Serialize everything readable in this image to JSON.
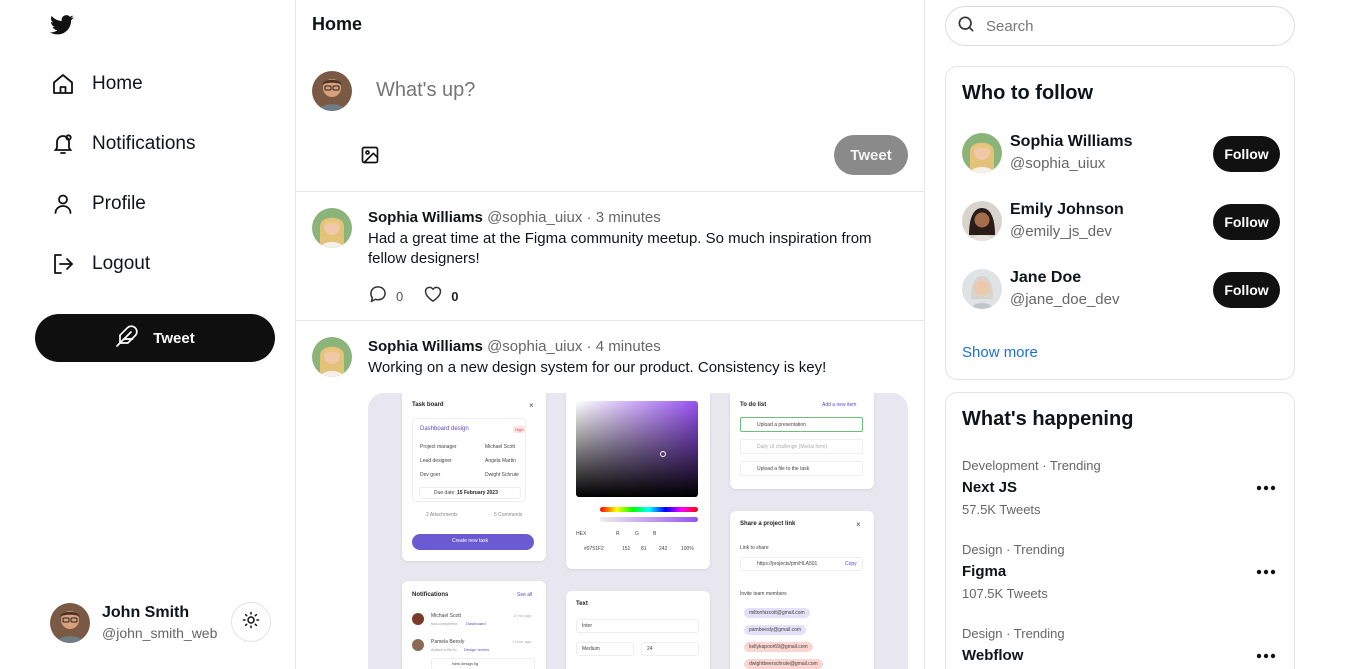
{
  "sidebar": {
    "logo_icon": "twitter-bird-icon",
    "nav": [
      {
        "label": "Home",
        "icon": "home-icon"
      },
      {
        "label": "Notifications",
        "icon": "bell-icon"
      },
      {
        "label": "Profile",
        "icon": "user-icon"
      },
      {
        "label": "Logout",
        "icon": "logout-icon"
      }
    ],
    "tweet_button": {
      "label": "Tweet",
      "icon": "feather-icon"
    },
    "current_user": {
      "name": "John Smith",
      "handle": "@john_smith_web"
    },
    "theme_toggle_icon": "sun-icon"
  },
  "main": {
    "title": "Home",
    "composer": {
      "placeholder": "What's up?",
      "media_icon": "image-icon",
      "tweet_label": "Tweet"
    },
    "posts": [
      {
        "author": "Sophia Williams",
        "handle": "@sophia_uiux",
        "dot": "·",
        "time": "3 minutes",
        "text": "Had a great time at the Figma community meetup. So much inspiration from fellow designers!",
        "comments": "0",
        "likes": "0"
      },
      {
        "author": "Sophia Williams",
        "handle": "@sophia_uiux",
        "dot": "·",
        "time": "4 minutes",
        "text": "Working on a new design system for our product. Consistency is key!",
        "image": {
          "task_board": {
            "title": "Task board",
            "close": "×",
            "project": "Dashboard design",
            "badge": "High",
            "roles": [
              {
                "role": "Project manager",
                "person": "Michael Scott"
              },
              {
                "role": "Lead designer",
                "person": "Angela Martin"
              },
              {
                "role": "Dev goer",
                "person": "Dwight Schrute"
              }
            ],
            "due_label": "Due date:",
            "due_date": "15 February 2023",
            "attachments": "2 Attachments",
            "comments": "5 Comments",
            "button": "Create new task"
          },
          "color_picker": {
            "labels": [
              "HEX",
              "R",
              "G",
              "B"
            ],
            "values": [
              "#9751F2",
              "151",
              "81",
              "242",
              "100%"
            ]
          },
          "todo": {
            "title": "To do list",
            "add": "Add a new item",
            "items": [
              "Upload a presentation",
              "Daily UI challenge (Modal form)",
              "Upload a file to the task"
            ]
          },
          "share": {
            "title": "Share a project link",
            "close": "×",
            "link_label": "Link to share",
            "link": "https://projects/pm/HLA501",
            "copy": "Copy",
            "invite_label": "Invite team members",
            "emails": [
              "miltonhizcott@gmail.com",
              "pambeesly@gmail.com",
              "kellykapoor69@gmail.com",
              "dwightbeerschrute@gmail.com"
            ]
          },
          "notifications": {
            "title": "Notifications",
            "see_all": "See all",
            "items": [
              {
                "name": "Michael Scott",
                "action": "has completed",
                "target": "Dashboard",
                "time": "2 min ago"
              },
              {
                "name": "Pamela Beesly",
                "action": "Added a file to",
                "target": "Design review",
                "time": "1 hour ago"
              }
            ],
            "file": "New design.fig"
          },
          "text_panel": {
            "title": "Text",
            "font": "Inter",
            "weight": "Medium",
            "size": "24"
          }
        }
      }
    ]
  },
  "right": {
    "search_placeholder": "Search",
    "who_to_follow": {
      "title": "Who to follow",
      "users": [
        {
          "name": "Sophia Williams",
          "handle": "@sophia_uiux",
          "button": "Follow"
        },
        {
          "name": "Emily Johnson",
          "handle": "@emily_js_dev",
          "button": "Follow"
        },
        {
          "name": "Jane Doe",
          "handle": "@jane_doe_dev",
          "button": "Follow"
        }
      ],
      "show_more": "Show more"
    },
    "happening": {
      "title": "What's happening",
      "trends": [
        {
          "meta": "Development · Trending",
          "name": "Next JS",
          "count": "57.5K Tweets"
        },
        {
          "meta": "Design · Trending",
          "name": "Figma",
          "count": "107.5K Tweets"
        },
        {
          "meta": "Design · Trending",
          "name": "Webflow",
          "count": ""
        }
      ]
    }
  },
  "colors": {
    "primary_button": "#111111",
    "disabled_button": "#8a8a8a",
    "link": "#1d70d8",
    "border": "#e6e6e6",
    "accent_purple": "#6b5bd2"
  }
}
